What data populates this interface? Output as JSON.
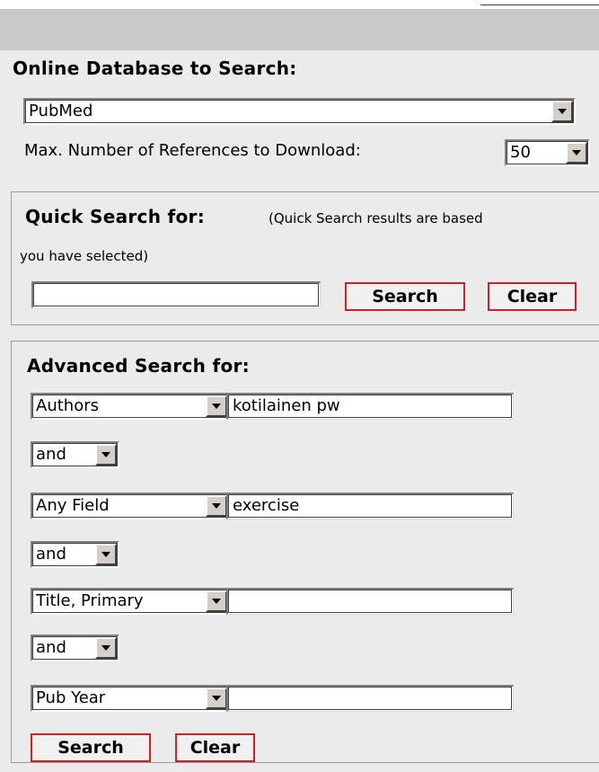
{
  "database": {
    "title": "Online Database to Search:",
    "selected": "PubMed",
    "max_label": "Max. Number of References to Download:",
    "max_value": "50"
  },
  "quick_search": {
    "title": "Quick Search for:",
    "note_line1": "(Quick Search results are based",
    "note_line2": "you have selected)",
    "input_value": "",
    "search_label": "Search",
    "clear_label": "Clear"
  },
  "advanced_search": {
    "title": "Advanced Search for:",
    "rows": [
      {
        "field": "Authors",
        "value": "kotilainen pw"
      },
      {
        "field": "Any Field",
        "value": "exercise"
      },
      {
        "field": "Title, Primary",
        "value": ""
      },
      {
        "field": "Pub Year",
        "value": ""
      }
    ],
    "operators": [
      "and",
      "and",
      "and"
    ],
    "search_label": "Search",
    "clear_label": "Clear"
  }
}
